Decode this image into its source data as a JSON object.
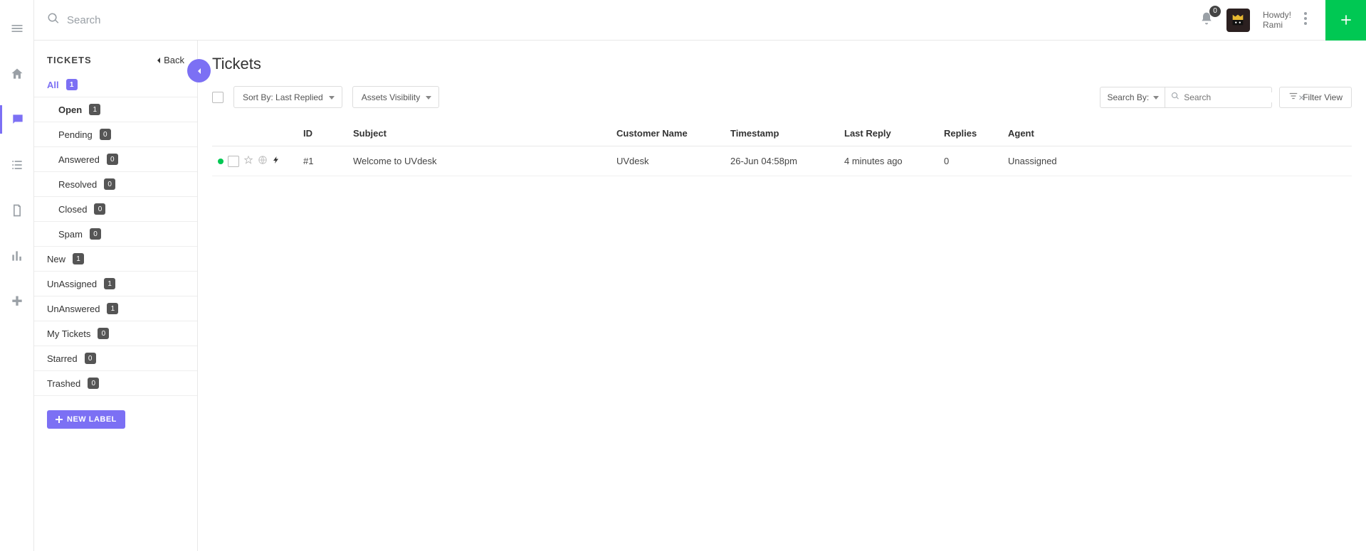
{
  "topbar": {
    "search_placeholder": "Search",
    "notification_count": "0",
    "greeting": "Howdy!",
    "username": "Rami"
  },
  "sidebar": {
    "title": "TICKETS",
    "back_label": "Back",
    "filters": [
      {
        "label": "All",
        "count": "1",
        "cls": "all top-level"
      },
      {
        "label": "Open",
        "count": "1",
        "cls": "open sub"
      },
      {
        "label": "Pending",
        "count": "0",
        "cls": "sub"
      },
      {
        "label": "Answered",
        "count": "0",
        "cls": "sub"
      },
      {
        "label": "Resolved",
        "count": "0",
        "cls": "sub"
      },
      {
        "label": "Closed",
        "count": "0",
        "cls": "sub"
      },
      {
        "label": "Spam",
        "count": "0",
        "cls": "sub"
      },
      {
        "label": "New",
        "count": "1",
        "cls": "top-level"
      },
      {
        "label": "UnAssigned",
        "count": "1",
        "cls": "top-level"
      },
      {
        "label": "UnAnswered",
        "count": "1",
        "cls": "top-level"
      },
      {
        "label": "My Tickets",
        "count": "0",
        "cls": "top-level"
      },
      {
        "label": "Starred",
        "count": "0",
        "cls": "top-level"
      },
      {
        "label": "Trashed",
        "count": "0",
        "cls": "top-level"
      }
    ],
    "new_label_btn": "NEW LABEL"
  },
  "main": {
    "page_title": "Tickets",
    "sort_label": "Sort By: Last Replied",
    "assets_label": "Assets Visibility",
    "search_by_label": "Search By:",
    "table_search_placeholder": "Search",
    "filter_view_label": "Filter View",
    "columns": {
      "id": "ID",
      "subject": "Subject",
      "customer": "Customer Name",
      "timestamp": "Timestamp",
      "lastreply": "Last Reply",
      "replies": "Replies",
      "agent": "Agent"
    },
    "rows": [
      {
        "id": "#1",
        "subject": "Welcome to UVdesk",
        "customer": "UVdesk",
        "timestamp": "26-Jun 04:58pm",
        "lastreply": "4 minutes ago",
        "replies": "0",
        "agent": "Unassigned"
      }
    ]
  }
}
